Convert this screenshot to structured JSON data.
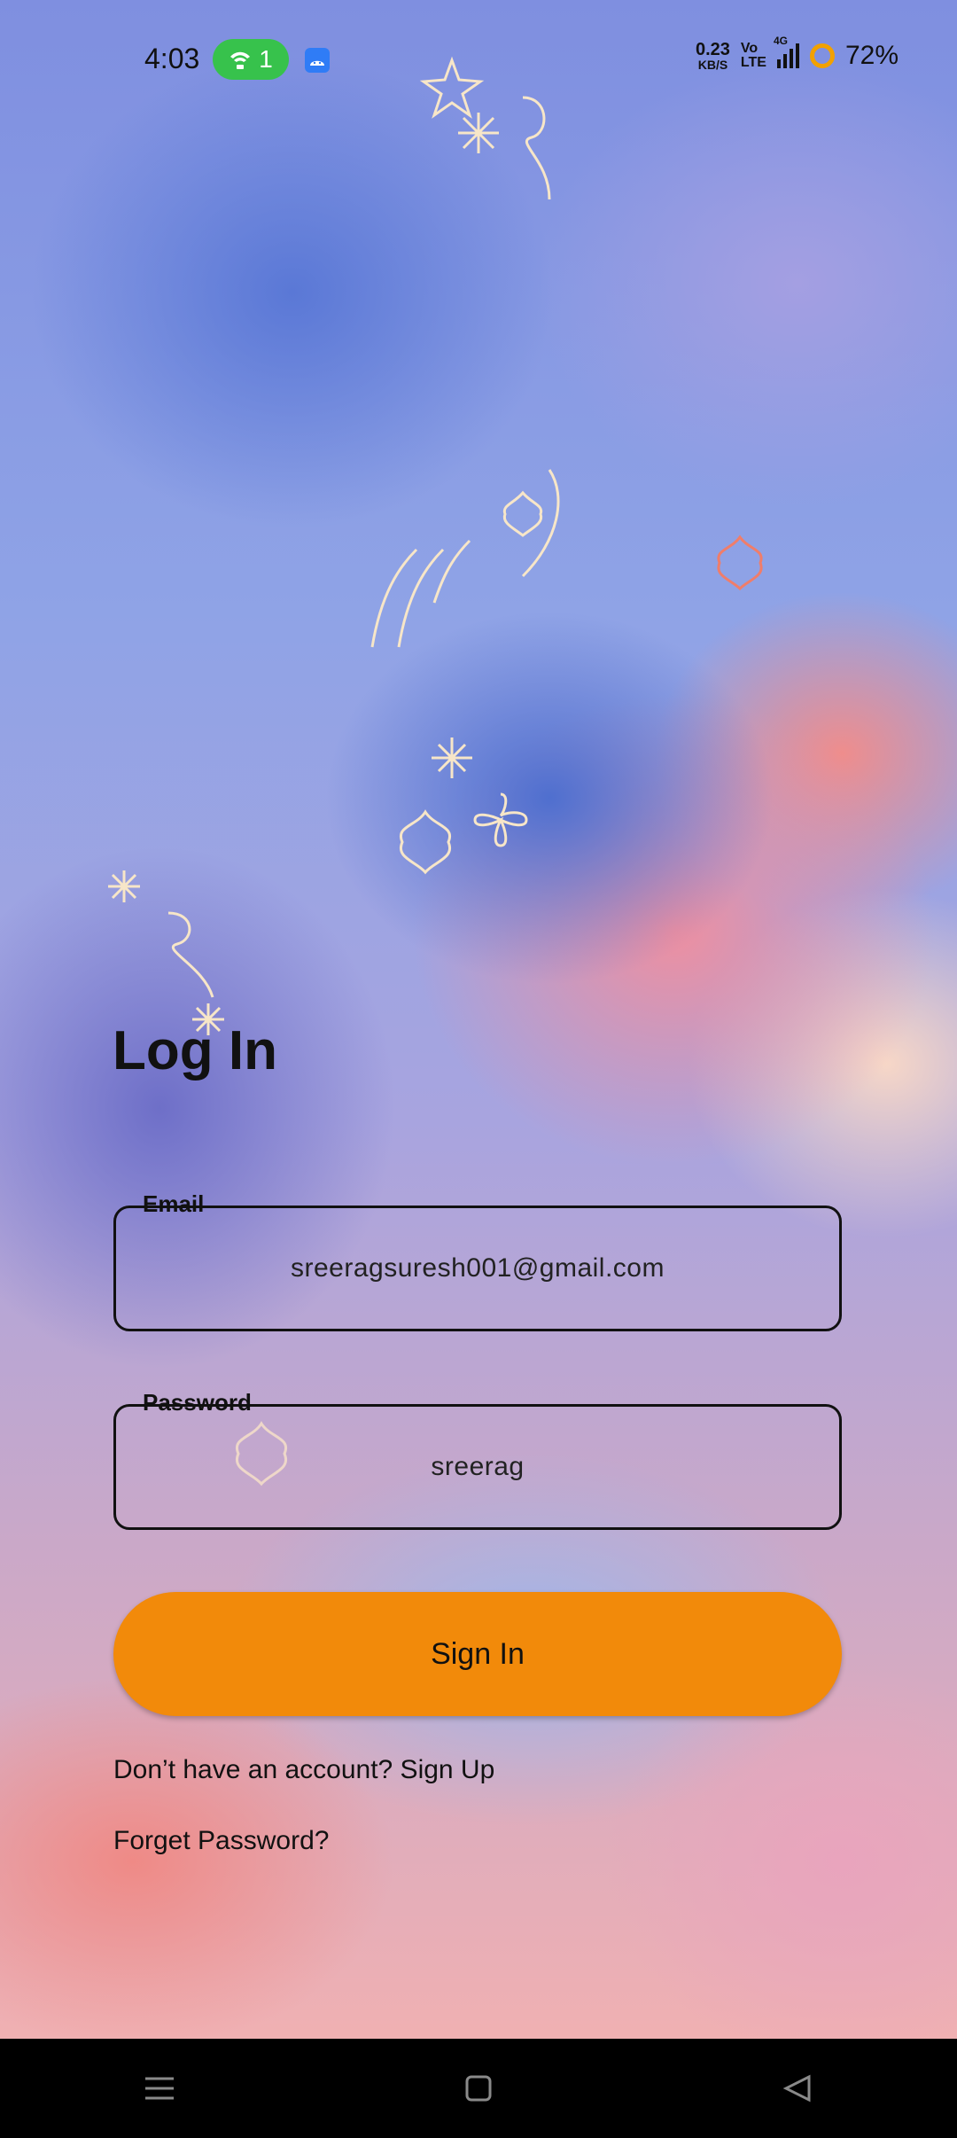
{
  "status_bar": {
    "time": "4:03",
    "hotspot_count": "1",
    "network_speed_value": "0.23",
    "network_speed_unit": "KB/S",
    "volte_top": "Vo",
    "volte_bottom": "LTE",
    "network_type": "4G",
    "battery": "72%"
  },
  "login": {
    "title": "Log In",
    "email_label": "Email",
    "email_value": "sreeragsuresh001@gmail.com",
    "password_label": "Password",
    "password_value": "sreerag",
    "sign_in_label": "Sign In",
    "signup_text": "Don’t have an account? Sign Up",
    "forget_text": "Forget Password?"
  },
  "colors": {
    "accent_button": "#f28a0a",
    "hotspot_badge": "#37c24c",
    "android_badge": "#2f7cf6"
  },
  "icons": {
    "hotspot": "wifi-hotspot-icon",
    "android": "android-icon",
    "signal": "signal-bars-icon",
    "battery": "battery-ring-icon",
    "nav_menu": "menu-icon",
    "nav_home": "home-square-icon",
    "nav_back": "back-triangle-icon"
  }
}
